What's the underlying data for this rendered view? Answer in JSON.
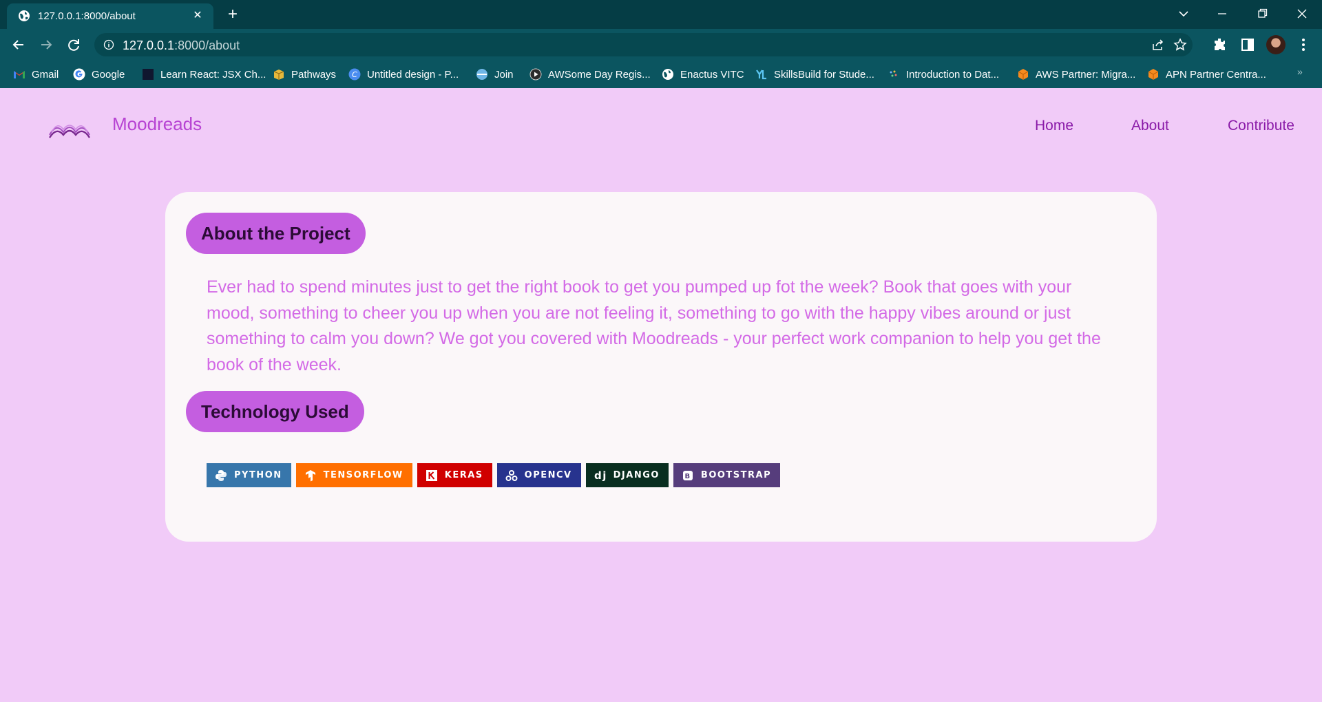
{
  "browser": {
    "tab": {
      "title": "127.0.0.1:8000/about"
    },
    "url": {
      "host": "127.0.0.1",
      "path": ":8000/about"
    },
    "bookmarks": [
      {
        "label": "Gmail",
        "icon": "gmail-icon"
      },
      {
        "label": "Google",
        "icon": "google-icon"
      },
      {
        "label": "Learn React: JSX Ch...",
        "icon": "codecademy-icon"
      },
      {
        "label": "Pathways",
        "icon": "box-icon"
      },
      {
        "label": "Untitled design - P...",
        "icon": "canva-icon"
      },
      {
        "label": "Join",
        "icon": "join-icon"
      },
      {
        "label": "AWSome Day Regis...",
        "icon": "play-icon"
      },
      {
        "label": "Enactus VITC",
        "icon": "globe-icon"
      },
      {
        "label": "SkillsBuild for Stude...",
        "icon": "yl-icon"
      },
      {
        "label": "Introduction to Dat...",
        "icon": "dots-icon"
      },
      {
        "label": "AWS Partner: Migra...",
        "icon": "aws-cube-icon"
      },
      {
        "label": "APN Partner Centra...",
        "icon": "aws-cube-icon"
      }
    ],
    "more_bookmarks": "»"
  },
  "site": {
    "brand": "Moodreads",
    "nav": [
      {
        "label": "Home"
      },
      {
        "label": "About"
      },
      {
        "label": "Contribute"
      }
    ]
  },
  "about": {
    "heading": "About the Project",
    "body": "Ever had to spend minutes just to get the right book to get you pumped up fot the week? Book that goes with your mood, something to cheer you up when you are not feeling it, something to go with the happy vibes around or just something to calm you down? We got you covered with Moodreads - your perfect work companion to help you get the book of the week."
  },
  "tech": {
    "heading": "Technology Used",
    "badges": [
      {
        "label": "PYTHON",
        "icon": "python-icon",
        "color": "#3776ab"
      },
      {
        "label": "TENSORFLOW",
        "icon": "tensorflow-icon",
        "color": "#ff6f00"
      },
      {
        "label": "KERAS",
        "icon": "keras-icon",
        "color": "#d00000"
      },
      {
        "label": "OPENCV",
        "icon": "opencv-icon",
        "color": "#27338e"
      },
      {
        "label": "DJANGO",
        "icon": "django-icon",
        "color": "#092e20"
      },
      {
        "label": "BOOTSTRAP",
        "icon": "bootstrap-icon",
        "color": "#563d7c"
      }
    ]
  },
  "colors": {
    "page_bg": "#f1cbf8",
    "card_bg": "#fbf7f9",
    "accent": "#c45ee0",
    "brand_text": "#b743d3",
    "body_text": "#d36ae6",
    "chrome": "#0b5560"
  }
}
